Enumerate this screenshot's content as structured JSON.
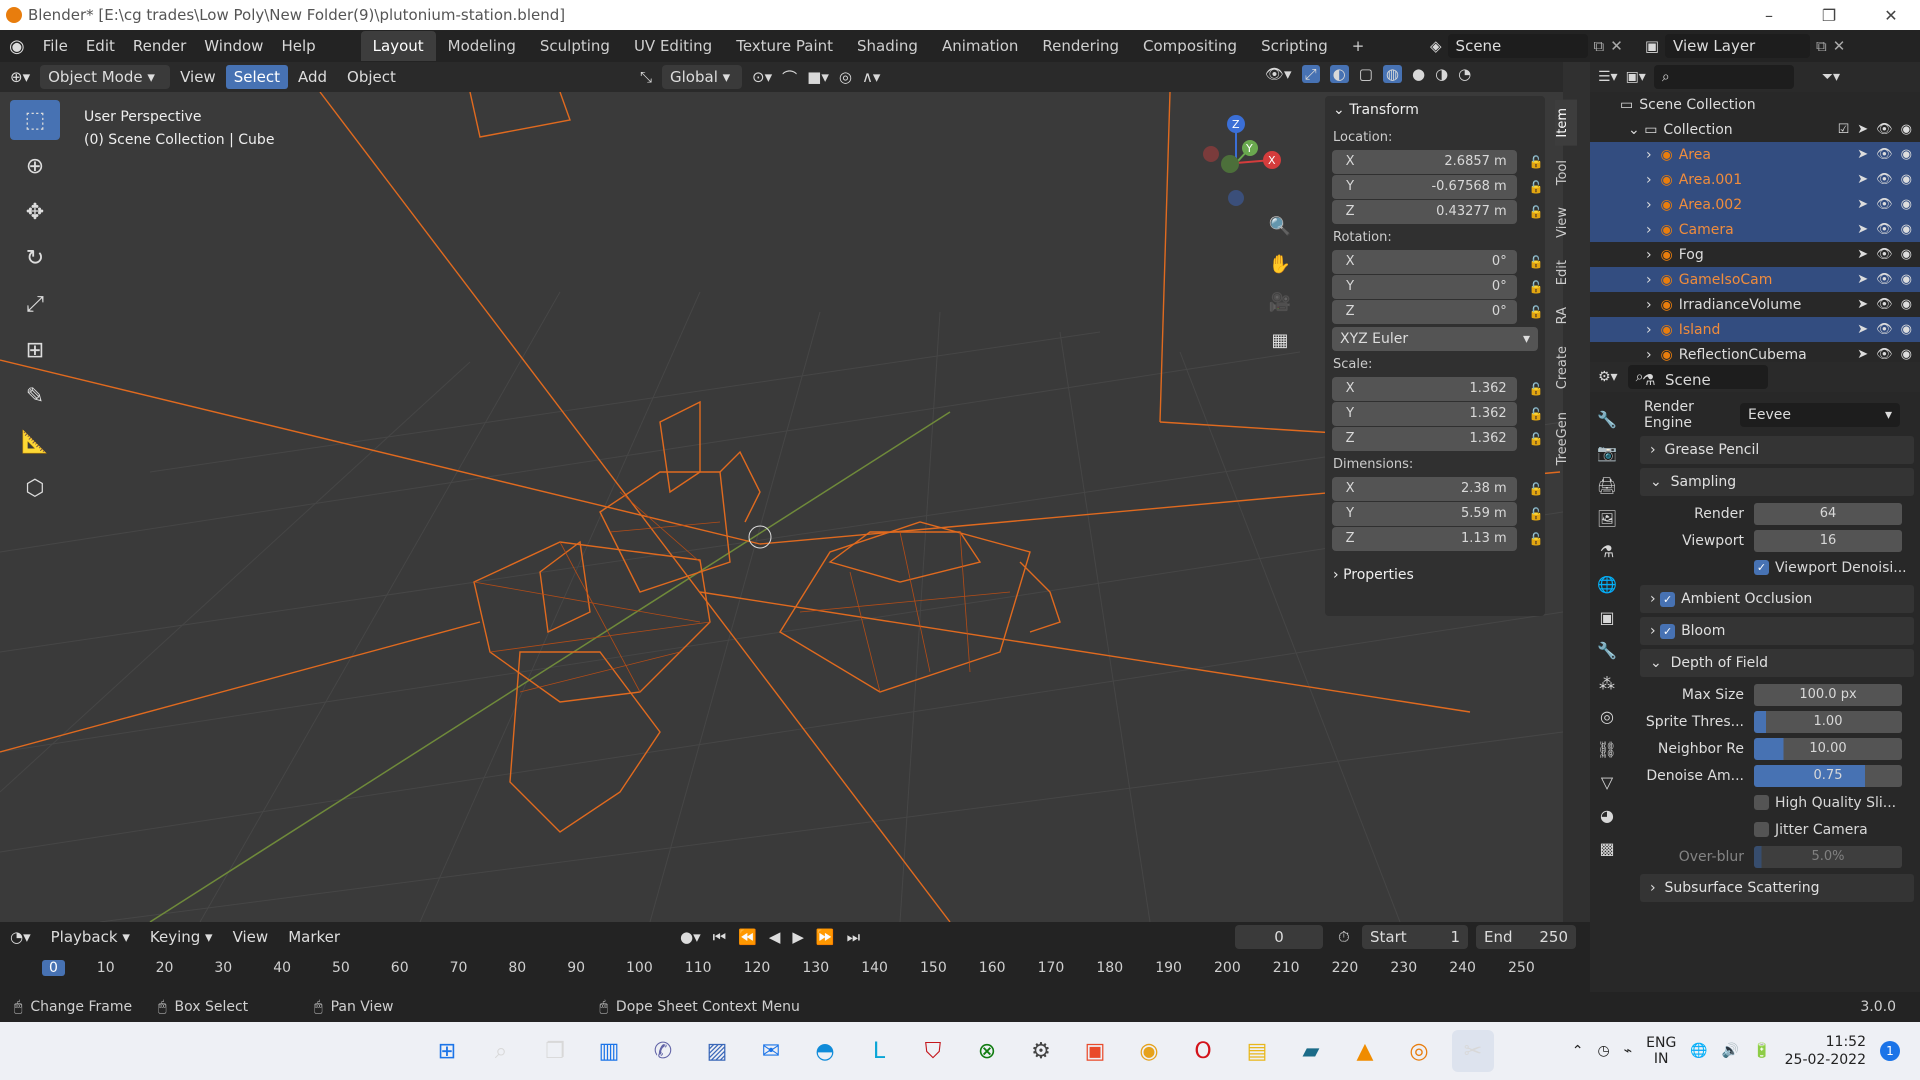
{
  "window": {
    "title": "Blender* [E:\\cg trades\\Low Poly\\New Folder(9)\\plutonium-station.blend]"
  },
  "menu": {
    "items": [
      "File",
      "Edit",
      "Render",
      "Window",
      "Help"
    ]
  },
  "workspaces": [
    "Layout",
    "Modeling",
    "Sculpting",
    "UV Editing",
    "Texture Paint",
    "Shading",
    "Animation",
    "Rendering",
    "Compositing",
    "Scripting"
  ],
  "active_workspace": "Layout",
  "scene": {
    "name": "Scene",
    "view_layer": "View Layer"
  },
  "header3d": {
    "mode": "Object Mode",
    "view": "View",
    "select": "Select",
    "add": "Add",
    "object": "Object",
    "orientation": "Global"
  },
  "viewport": {
    "perspective": "User Perspective",
    "collection": "(0) Scene Collection | Cube"
  },
  "gizmo": {
    "x": "X",
    "y": "Y",
    "z": "Z"
  },
  "npanel": {
    "transform": "Transform",
    "location_label": "Location:",
    "location": [
      {
        "ax": "X",
        "v": "2.6857 m"
      },
      {
        "ax": "Y",
        "v": "-0.67568 m"
      },
      {
        "ax": "Z",
        "v": "0.43277 m"
      }
    ],
    "rotation_label": "Rotation:",
    "rotation": [
      {
        "ax": "X",
        "v": "0°"
      },
      {
        "ax": "Y",
        "v": "0°"
      },
      {
        "ax": "Z",
        "v": "0°"
      }
    ],
    "rotation_mode": "XYZ Euler",
    "scale_label": "Scale:",
    "scale": [
      {
        "ax": "X",
        "v": "1.362"
      },
      {
        "ax": "Y",
        "v": "1.362"
      },
      {
        "ax": "Z",
        "v": "1.362"
      }
    ],
    "dimensions_label": "Dimensions:",
    "dimensions": [
      {
        "ax": "X",
        "v": "2.38 m"
      },
      {
        "ax": "Y",
        "v": "5.59 m"
      },
      {
        "ax": "Z",
        "v": "1.13 m"
      }
    ],
    "properties": "Properties"
  },
  "vtabs": [
    "Item",
    "Tool",
    "View",
    "Edit",
    "RA",
    "Create",
    "TreeGen"
  ],
  "outliner": {
    "root": "Scene Collection",
    "collection": "Collection",
    "items": [
      {
        "name": "Area",
        "selected": true
      },
      {
        "name": "Area.001",
        "selected": true
      },
      {
        "name": "Area.002",
        "selected": true
      },
      {
        "name": "Camera",
        "selected": true
      },
      {
        "name": "Fog",
        "selected": false
      },
      {
        "name": "GameIsoCam",
        "selected": true
      },
      {
        "name": "IrradianceVolume",
        "selected": false
      },
      {
        "name": "Island",
        "selected": true
      },
      {
        "name": "ReflectionCubema",
        "selected": false
      }
    ]
  },
  "properties": {
    "title": "Scene",
    "render_engine_label": "Render Engine",
    "render_engine": "Eevee",
    "grease_pencil": "Grease Pencil",
    "sampling": "Sampling",
    "render_label": "Render",
    "render_value": "64",
    "viewport_label": "Viewport",
    "viewport_value": "16",
    "viewport_denoise": "Viewport Denoisi...",
    "ambient_occlusion": "Ambient Occlusion",
    "bloom": "Bloom",
    "dof": "Depth of Field",
    "max_size_label": "Max Size",
    "max_size": "100.0 px",
    "sprite_label": "Sprite Thres...",
    "sprite": "1.00",
    "neighbor_label": "Neighbor Re",
    "neighbor": "10.00",
    "denoise_label": "Denoise Am...",
    "denoise": "0.75",
    "high_quality": "High Quality Sli...",
    "jitter": "Jitter Camera",
    "overblur_label": "Over-blur",
    "overblur": "5.0%",
    "subsurface": "Subsurface Scattering"
  },
  "timeline": {
    "playback": "Playback",
    "keying": "Keying",
    "view": "View",
    "marker": "Marker",
    "current_frame": "0",
    "start_label": "Start",
    "start": "1",
    "end_label": "End",
    "end": "250",
    "ruler": [
      "0",
      "10",
      "20",
      "30",
      "40",
      "50",
      "60",
      "70",
      "80",
      "90",
      "100",
      "110",
      "120",
      "130",
      "140",
      "150",
      "160",
      "170",
      "180",
      "190",
      "200",
      "210",
      "220",
      "230",
      "240",
      "250"
    ]
  },
  "status": {
    "change_frame": "Change Frame",
    "box_select": "Box Select",
    "pan_view": "Pan View",
    "context_menu": "Dope Sheet Context Menu",
    "version": "3.0.0"
  },
  "tray": {
    "lang1": "ENG",
    "lang2": "IN",
    "time": "11:52",
    "date": "25-02-2022",
    "badge": "1"
  },
  "colors": {
    "accent": "#4772b3",
    "wire": "#e06a1f",
    "selected_text": "#f08c3c"
  }
}
